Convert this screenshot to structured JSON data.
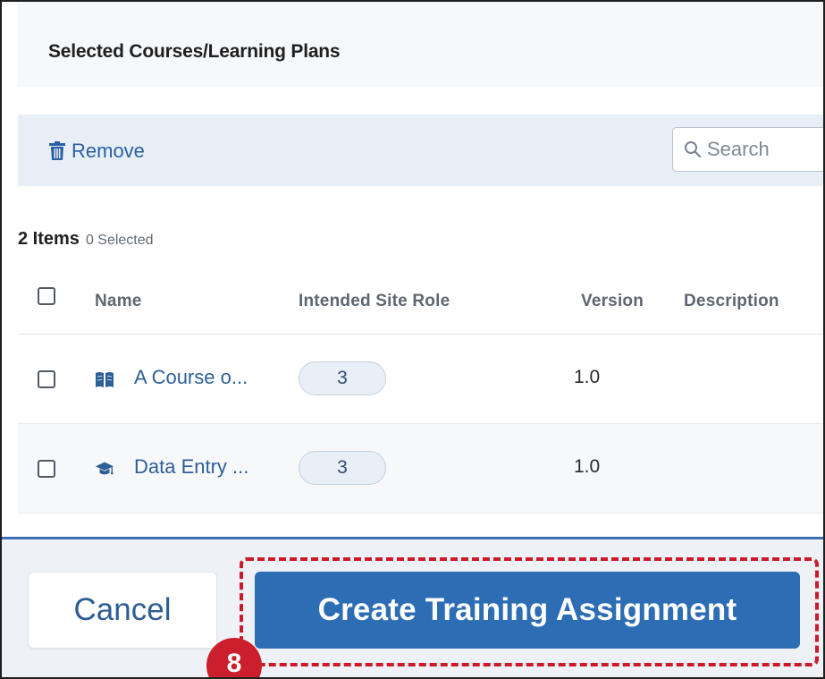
{
  "panel": {
    "title": "Selected Courses/Learning Plans"
  },
  "toolbar": {
    "remove_label": "Remove",
    "remove_icon": "trash-icon",
    "search": {
      "placeholder": "Search",
      "value": "",
      "icon": "search-icon"
    }
  },
  "summary": {
    "items_label": "2 Items",
    "selected_label": "0 Selected"
  },
  "table": {
    "columns": [
      "Name",
      "Intended Site Role",
      "Version",
      "Description"
    ],
    "rows": [
      {
        "icon": "open-book-icon",
        "name": "A Course o...",
        "role_count": "3",
        "version": "1.0",
        "description": ""
      },
      {
        "icon": "graduation-cap-icon",
        "name": "Data Entry ...",
        "role_count": "3",
        "version": "1.0",
        "description": ""
      }
    ]
  },
  "footer": {
    "cancel_label": "Cancel",
    "create_label": "Create Training Assignment",
    "step_badge": "8"
  },
  "colors": {
    "primary": "#2d6db4",
    "link": "#2d5f97",
    "highlight": "#cc1a2b",
    "toolbar_bg": "#e8eef5"
  }
}
